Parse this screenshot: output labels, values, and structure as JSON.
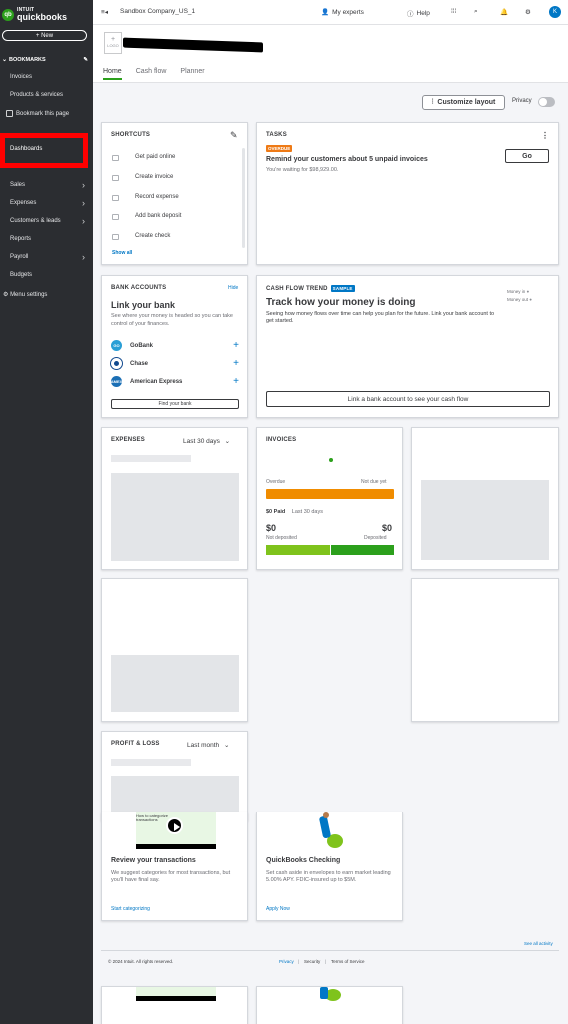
{
  "brand": {
    "intuit": "INTUIT",
    "name": "quickbooks",
    "logo_glyph": "qb",
    "accent": "#2ca01c",
    "link": "#0077c5"
  },
  "sidebar": {
    "new_label": "+ New",
    "bookmarks_label": "BOOKMARKS",
    "items": {
      "invoices": "Invoices",
      "products": "Products & services",
      "bookmark_page": "Bookmark this page",
      "dashboards": "Dashboards",
      "sales": "Sales",
      "expenses": "Expenses",
      "customers": "Customers & leads",
      "reports": "Reports",
      "payroll": "Payroll",
      "budgets": "Budgets",
      "menu_settings": "Menu settings"
    }
  },
  "topbar": {
    "company": "Sandbox Company_US_1",
    "my_experts": "My experts",
    "help": "Help",
    "avatar_initial": "K"
  },
  "header": {
    "logo_placeholder": "LOGO",
    "logo_plus": "+",
    "tabs": [
      "Home",
      "Cash flow",
      "Planner"
    ]
  },
  "toolbar": {
    "customize": "Customize layout",
    "privacy": "Privacy"
  },
  "shortcuts": {
    "title": "SHORTCUTS",
    "items": [
      "Get paid online",
      "Create invoice",
      "Record expense",
      "Add bank deposit",
      "Create check"
    ],
    "show_all": "Show all"
  },
  "tasks": {
    "title": "TASKS",
    "badge": "OVERDUE",
    "headline": "Remind your customers about 5 unpaid invoices",
    "sub": "You're waiting for $98,929.00.",
    "go": "Go"
  },
  "bank_accounts": {
    "title": "BANK ACCOUNTS",
    "hide": "Hide",
    "headline": "Link your bank",
    "sub": "See where your money is headed so you can take control of your finances.",
    "banks": [
      {
        "name": "GoBank",
        "logo": "GO",
        "color": "#2a9fd6"
      },
      {
        "name": "Chase",
        "logo": "",
        "color": "#124a8f"
      },
      {
        "name": "American Express",
        "logo": "AMEX",
        "color": "#1b6fb5"
      }
    ],
    "find_bank": "Find your bank"
  },
  "cash_flow": {
    "title": "CASH FLOW TREND",
    "badge": "SAMPLE",
    "headline": "Track how your money is doing",
    "sub": "Seeing how money flows over time can help you plan for the future. Link your bank account to get started.",
    "legend_in": "Money in",
    "legend_out": "Money out",
    "cta": "Link a bank account to see your cash flow"
  },
  "expenses": {
    "title": "EXPENSES",
    "period": "Last 30 days"
  },
  "invoices": {
    "title": "INVOICES",
    "overdue_label": "Overdue",
    "not_due_label": "Not due yet",
    "paid_label": "$0 Paid",
    "paid_period": "Last 30 days",
    "not_deposited_amount": "$0",
    "deposited_amount": "$0",
    "not_deposited_label": "Not deposited",
    "deposited_label": "Deposited",
    "colors": {
      "overdue": "#f08c00",
      "not_deposited": "#7fc31c",
      "deposited": "#2ca01c"
    }
  },
  "profit_loss": {
    "title": "PROFIT & LOSS",
    "period": "Last month"
  },
  "promos": [
    {
      "title": "Review your transactions",
      "body": "We suggest categories for most transactions, but you'll have final say.",
      "link": "Start categorizing",
      "img_text": "How to categorize transactions"
    },
    {
      "title": "QuickBooks Checking",
      "body": "Set cash aside in envelopes to earn market leading 5.00% APY. FDIC-insured up to $5M.",
      "link": "Apply Now"
    }
  ],
  "see_all": "See all activity",
  "footer": {
    "copyright": "© 2024 Intuit. All rights reserved.",
    "privacy": "Privacy",
    "security": "Security",
    "terms": "Terms of Service"
  }
}
